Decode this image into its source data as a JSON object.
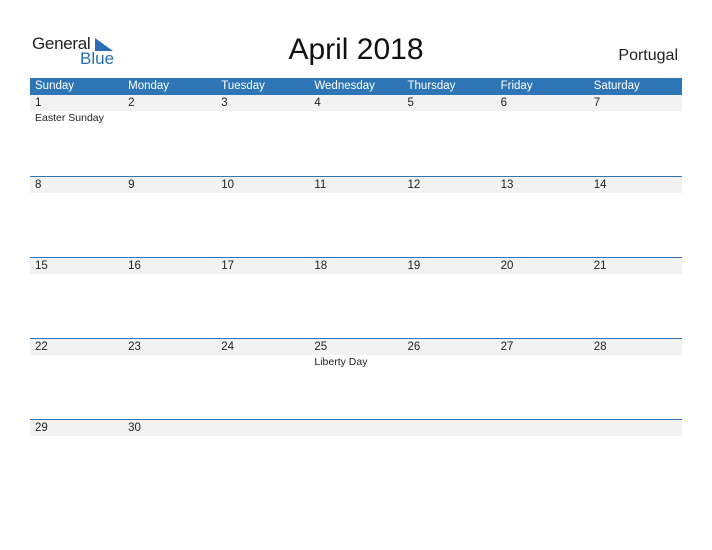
{
  "logo": {
    "general": "General",
    "blue": "Blue"
  },
  "title": "April 2018",
  "country": "Portugal",
  "weekdays": [
    "Sunday",
    "Monday",
    "Tuesday",
    "Wednesday",
    "Thursday",
    "Friday",
    "Saturday"
  ],
  "weeks": [
    {
      "days": [
        "1",
        "2",
        "3",
        "4",
        "5",
        "6",
        "7"
      ],
      "events": [
        "Easter Sunday",
        "",
        "",
        "",
        "",
        "",
        ""
      ]
    },
    {
      "days": [
        "8",
        "9",
        "10",
        "11",
        "12",
        "13",
        "14"
      ],
      "events": [
        "",
        "",
        "",
        "",
        "",
        "",
        ""
      ]
    },
    {
      "days": [
        "15",
        "16",
        "17",
        "18",
        "19",
        "20",
        "21"
      ],
      "events": [
        "",
        "",
        "",
        "",
        "",
        "",
        ""
      ]
    },
    {
      "days": [
        "22",
        "23",
        "24",
        "25",
        "26",
        "27",
        "28"
      ],
      "events": [
        "",
        "",
        "",
        "Liberty Day",
        "",
        "",
        ""
      ]
    },
    {
      "days": [
        "29",
        "30",
        "",
        "",
        "",
        "",
        ""
      ],
      "events": [
        "",
        "",
        "",
        "",
        "",
        "",
        ""
      ]
    }
  ],
  "colors": {
    "accent": "#2e75b6",
    "day_strip": "#f2f2f2"
  }
}
